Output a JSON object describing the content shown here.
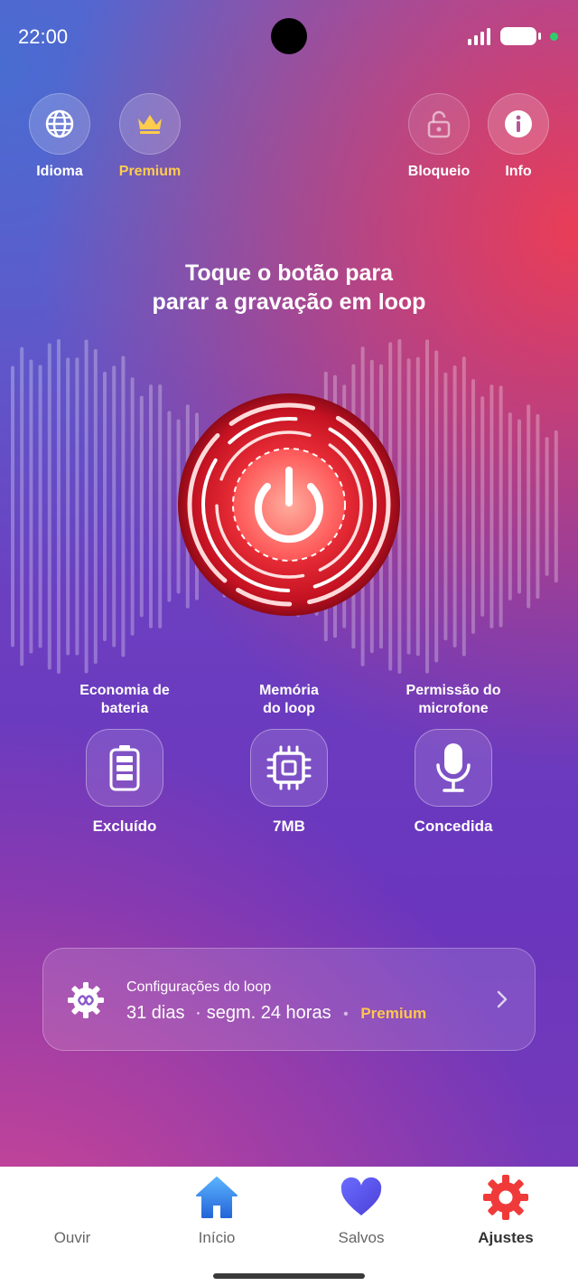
{
  "status_bar": {
    "time": "22:00"
  },
  "top_actions": [
    {
      "label": "Idioma",
      "icon": "globe-icon"
    },
    {
      "label": "Premium",
      "icon": "crown-icon",
      "color": "#ffcc4d"
    },
    {
      "label": "Bloqueio",
      "icon": "lock-icon"
    },
    {
      "label": "Info",
      "icon": "info-icon"
    }
  ],
  "headline": {
    "line1": "Toque o botão para",
    "line2": "parar a gravação em loop"
  },
  "features": [
    {
      "title_line1": "Economia de",
      "title_line2": "bateria",
      "value": "Excluído",
      "icon": "battery-icon"
    },
    {
      "title_line1": "Memória",
      "title_line2": "do loop",
      "value": "7MB",
      "icon": "memory-chip-icon"
    },
    {
      "title_line1": "Permissão do",
      "title_line2": "microfone",
      "value": "Concedida",
      "icon": "microphone-icon"
    }
  ],
  "loop_settings": {
    "title": "Configurações do loop",
    "days": "31 dias",
    "separator": "·",
    "segment": "segm. 24 horas",
    "bullet": "•",
    "premium_label": "Premium"
  },
  "bottom_nav": [
    {
      "label": "Ouvir",
      "icon": "soundwave-icon"
    },
    {
      "label": "Início",
      "icon": "home-icon"
    },
    {
      "label": "Salvos",
      "icon": "heart-icon"
    },
    {
      "label": "Ajustes",
      "icon": "settings-gear-icon",
      "active": true
    }
  ],
  "colors": {
    "premium": "#ffc64d",
    "record_red": "#e8232f",
    "accent_blue": "#2f7de1"
  }
}
